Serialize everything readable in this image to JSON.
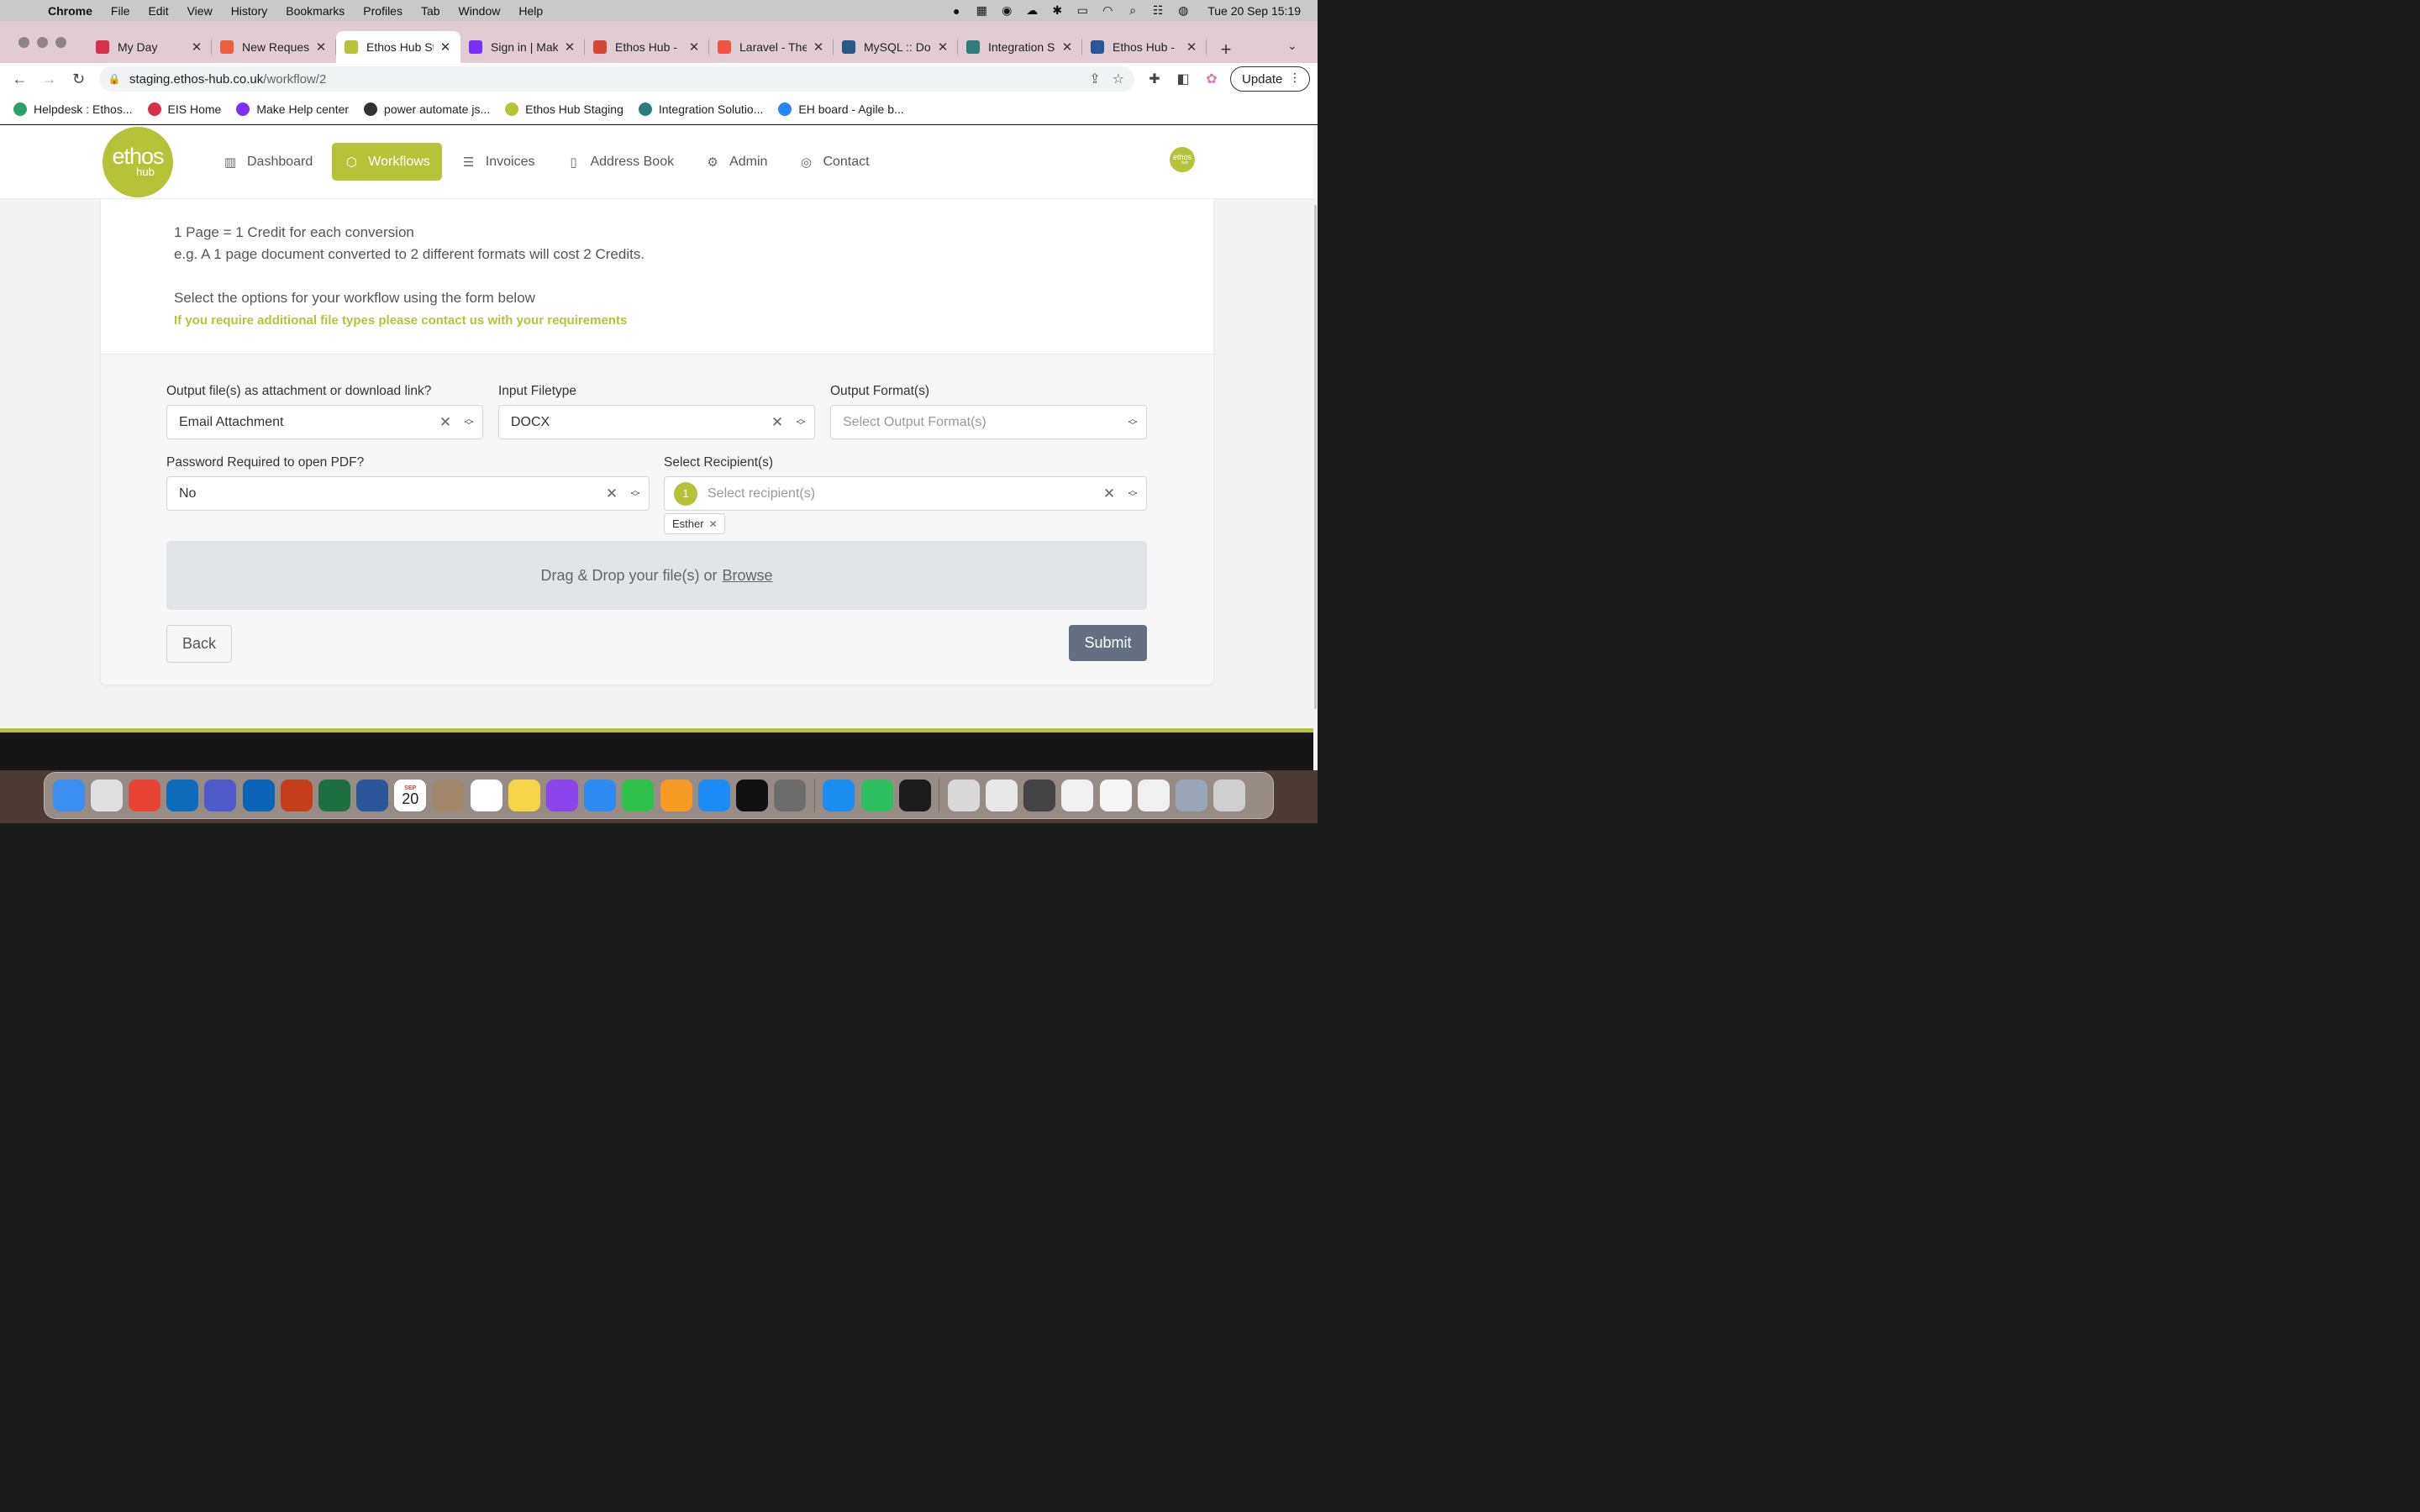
{
  "menubar": {
    "app": "Chrome",
    "items": [
      "File",
      "Edit",
      "View",
      "History",
      "Bookmarks",
      "Profiles",
      "Tab",
      "Window",
      "Help"
    ],
    "clock": "Tue 20 Sep  15:19"
  },
  "tabs": [
    {
      "title": "My Day",
      "color": "#d9304a"
    },
    {
      "title": "New Request",
      "color": "#e8613c"
    },
    {
      "title": "Ethos Hub Staging",
      "color": "#b6c237"
    },
    {
      "title": "Sign in | Make",
      "color": "#7b2ff7"
    },
    {
      "title": "Ethos Hub -",
      "color": "#d44638"
    },
    {
      "title": "Laravel - The",
      "color": "#f05340"
    },
    {
      "title": "MySQL :: Do",
      "color": "#2a5a8a"
    },
    {
      "title": "Integration S",
      "color": "#2d7d7d"
    },
    {
      "title": "Ethos Hub -",
      "color": "#2b579a"
    }
  ],
  "toolbar": {
    "url_host": "staging.ethos-hub.co.uk",
    "url_path": "/workflow/2",
    "update_label": "Update"
  },
  "bookmarks": [
    {
      "label": "Helpdesk : Ethos...",
      "color": "#2e9e6b"
    },
    {
      "label": "EIS Home",
      "color": "#d9304a"
    },
    {
      "label": "Make Help center",
      "color": "#7b2ff7"
    },
    {
      "label": "power automate js...",
      "color": "#333333"
    },
    {
      "label": "Ethos Hub Staging",
      "color": "#b6c237"
    },
    {
      "label": "Integration Solutio...",
      "color": "#2d7d7d"
    },
    {
      "label": "EH board - Agile b...",
      "color": "#2684ff"
    }
  ],
  "site": {
    "logo_line1": "ethos",
    "logo_line2": "hub",
    "nav": [
      {
        "label": "Dashboard",
        "icon": "bar-chart-icon",
        "glyph": "▥",
        "active": false
      },
      {
        "label": "Workflows",
        "icon": "box-icon",
        "glyph": "⬡",
        "active": true
      },
      {
        "label": "Invoices",
        "icon": "invoice-icon",
        "glyph": "☰",
        "active": false
      },
      {
        "label": "Address Book",
        "icon": "book-icon",
        "glyph": "▯",
        "active": false
      },
      {
        "label": "Admin",
        "icon": "gear-icon",
        "glyph": "⚙",
        "active": false
      },
      {
        "label": "Contact",
        "icon": "lifebuoy-icon",
        "glyph": "◎",
        "active": false
      }
    ],
    "avatar_line1": "ethos",
    "avatar_line2": "hub",
    "accent_color": "#b6c237"
  },
  "info": {
    "line1": "1 Page = 1 Credit for each conversion",
    "line2": "e.g. A 1 page document converted to 2 different formats will cost 2 Credits.",
    "line3": "Select the options for your workflow using the form below",
    "highlight": "If you require additional file types please contact us with your requirements"
  },
  "form": {
    "output_label": "Output file(s) as attachment or download link?",
    "output_value": "Email Attachment",
    "input_type_label": "Input Filetype",
    "input_type_value": "DOCX",
    "output_format_label": "Output Format(s)",
    "output_format_placeholder": "Select Output Format(s)",
    "password_label": "Password Required to open PDF?",
    "password_value": "No",
    "recipients_label": "Select Recipient(s)",
    "recipients_count": "1",
    "recipients_placeholder": "Select recipient(s)",
    "recipient_chip": "Esther",
    "dropzone_text": "Drag & Drop your file(s) or",
    "dropzone_browse": "Browse",
    "back_label": "Back",
    "submit_label": "Submit"
  },
  "dock": [
    {
      "name": "finder-icon",
      "color": "#3b8ff0"
    },
    {
      "name": "launchpad-icon",
      "color": "#e0e0e0"
    },
    {
      "name": "chrome-icon",
      "color": "#e94335"
    },
    {
      "name": "onedrive-icon",
      "color": "#0f6cbd"
    },
    {
      "name": "teams-icon",
      "color": "#5059c9"
    },
    {
      "name": "outlook-icon",
      "color": "#0a64b7"
    },
    {
      "name": "powerpoint-icon",
      "color": "#c43e1c"
    },
    {
      "name": "excel-icon",
      "color": "#1d6f42"
    },
    {
      "name": "word-icon",
      "color": "#2b579a"
    },
    {
      "name": "calendar-icon",
      "color": "#ffffff"
    },
    {
      "name": "contacts-icon",
      "color": "#a0876a"
    },
    {
      "name": "reminders-icon",
      "color": "#ffffff"
    },
    {
      "name": "notes-icon",
      "color": "#f5d547"
    },
    {
      "name": "podcasts-icon",
      "color": "#8e44ec"
    },
    {
      "name": "keynote-icon",
      "color": "#2c8cf4"
    },
    {
      "name": "numbers-icon",
      "color": "#2fbf4b"
    },
    {
      "name": "pages-icon",
      "color": "#f59a23"
    },
    {
      "name": "app-store-icon",
      "color": "#1b8cf5"
    },
    {
      "name": "phpstorm-icon",
      "color": "#111111"
    },
    {
      "name": "system-preferences-icon",
      "color": "#6d6d6d"
    },
    {
      "name": "safari-icon",
      "color": "#1a8ef0"
    },
    {
      "name": "evernote-icon",
      "color": "#2dbe60"
    },
    {
      "name": "terminal-icon",
      "color": "#1c1c1c"
    },
    {
      "name": "documents-folder-icon",
      "color": "#d9d9d9"
    },
    {
      "name": "window-thumb-icon-1",
      "color": "#e8e8e8"
    },
    {
      "name": "window-thumb-icon-2",
      "color": "#444444"
    },
    {
      "name": "window-thumb-icon-3",
      "color": "#f0f0f0"
    },
    {
      "name": "window-thumb-icon-4",
      "color": "#f6f6f6"
    },
    {
      "name": "window-thumb-icon-5",
      "color": "#f0f0f0"
    },
    {
      "name": "window-thumb-icon-6",
      "color": "#9aa6b8"
    },
    {
      "name": "trash-icon",
      "color": "#cfcfcf"
    }
  ],
  "dock_calendar": {
    "month": "SEP",
    "day": "20"
  }
}
